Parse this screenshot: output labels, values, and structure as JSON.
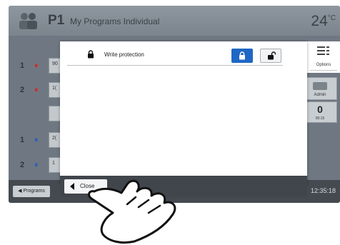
{
  "header": {
    "program_id": "P1",
    "program_name": "My Programs Individual",
    "temperature": "24",
    "temperature_unit": "°C"
  },
  "background_rows": [
    {
      "num": "1",
      "cell": "90"
    },
    {
      "num": "2",
      "cell": "1("
    },
    {
      "num": "1",
      "cell": "2("
    },
    {
      "num": "2",
      "cell": "1"
    }
  ],
  "right_panel": {
    "admin_label": "Admin",
    "counter_value": "0",
    "counter_time": "00:15"
  },
  "dialog": {
    "label": "Write protection"
  },
  "options": {
    "label": "Options"
  },
  "bottom": {
    "programs_label": "Programs",
    "close_label": "Close",
    "clock": "12:35:18"
  },
  "colors": {
    "accent_blue": "#1f67c4",
    "flag_red": "#d22b2b",
    "flag_blue": "#2a61b8"
  }
}
